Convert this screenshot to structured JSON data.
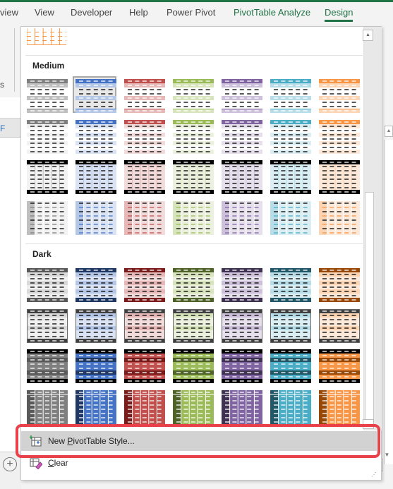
{
  "ribbon": {
    "tabs": [
      {
        "label": "view",
        "kind": "normal"
      },
      {
        "label": "View",
        "kind": "normal"
      },
      {
        "label": "Developer",
        "kind": "normal"
      },
      {
        "label": "Help",
        "kind": "normal"
      },
      {
        "label": "Power Pivot",
        "kind": "normal"
      },
      {
        "label": "PivotTable Analyze",
        "kind": "contextual"
      },
      {
        "label": "Design",
        "kind": "active"
      }
    ],
    "group_fragment": "s"
  },
  "sheet": {
    "column_fragment": "F",
    "add_sheet_symbol": "+"
  },
  "gallery": {
    "sections": [
      {
        "title": "Medium"
      },
      {
        "title": "Dark"
      }
    ],
    "colors": {
      "gray": {
        "dark": "#595959",
        "mid": "#7f7f7f",
        "light": "#d9d9d9",
        "pale": "#efefef"
      },
      "blue": {
        "dark": "#1f3864",
        "mid": "#4472c4",
        "light": "#b4c7e7",
        "pale": "#dae3f3"
      },
      "red": {
        "dark": "#7b1c1c",
        "mid": "#c0504d",
        "light": "#e6b8b7",
        "pale": "#f2dcdb"
      },
      "green": {
        "dark": "#4f6228",
        "mid": "#9bbb59",
        "light": "#d7e4bc",
        "pale": "#ebf1de"
      },
      "purple": {
        "dark": "#3f3151",
        "mid": "#8064a2",
        "light": "#ccc0da",
        "pale": "#e5e0ec"
      },
      "teal": {
        "dark": "#215867",
        "mid": "#4bacc6",
        "light": "#b7dee8",
        "pale": "#daeef3"
      },
      "orange": {
        "dark": "#984807",
        "mid": "#f79646",
        "light": "#fcd5b4",
        "pale": "#fde9d9"
      }
    },
    "selected_style": "Medium 2",
    "commands": [
      {
        "label": "New PivotTable Style...",
        "mnemonic": "P",
        "icon": "new-style-icon",
        "highlighted": true
      },
      {
        "label": "Clear",
        "mnemonic": "C",
        "icon": "clear-style-icon",
        "highlighted": false
      }
    ]
  },
  "annotation": {
    "highlight_color": "#e8414a"
  }
}
